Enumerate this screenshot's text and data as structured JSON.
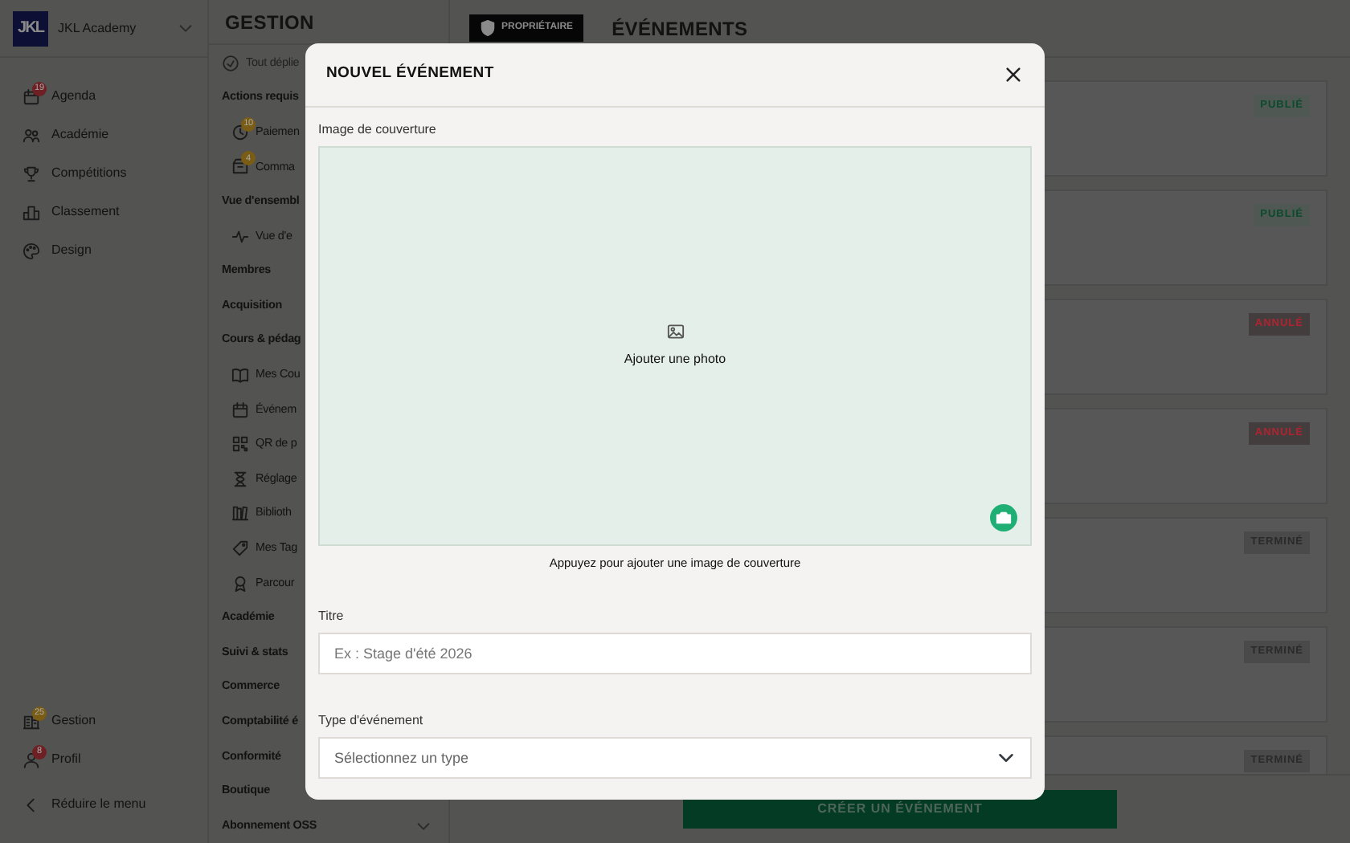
{
  "sidebar": {
    "logo": "JKL",
    "academy": "JKL Academy",
    "items": [
      {
        "label": "Agenda",
        "badge": {
          "text": "19",
          "color": "#6e2024"
        }
      },
      {
        "label": "Académie"
      },
      {
        "label": "Compétitions"
      },
      {
        "label": "Classement"
      },
      {
        "label": "Design"
      }
    ],
    "bottom_items": [
      {
        "label": "Gestion",
        "badge": {
          "text": "25",
          "color": "#7a5c14"
        }
      },
      {
        "label": "Profil",
        "badge": {
          "text": "8",
          "color": "#6e2024"
        }
      }
    ],
    "collapse": "Réduire le menu"
  },
  "subnav": {
    "title": "GESTION",
    "expand_all": "Tout déplie",
    "sections": [
      {
        "label": "Actions requis",
        "children": [
          {
            "label": "Paiemen",
            "badge": {
              "text": "10",
              "color": "#7a5c14"
            }
          },
          {
            "label": "Comma",
            "badge": {
              "text": "4",
              "color": "#7a5c14"
            }
          }
        ]
      },
      {
        "label": "Vue d'ensembl",
        "children": [
          {
            "label": "Vue d'e"
          }
        ]
      },
      {
        "label": "Membres"
      },
      {
        "label": "Acquisition"
      },
      {
        "label": "Cours & pédag",
        "children": [
          {
            "label": "Mes Cou"
          },
          {
            "label": "Événem"
          },
          {
            "label": "QR de p"
          },
          {
            "label": "Réglage"
          },
          {
            "label": "Biblioth"
          },
          {
            "label": "Mes Tag"
          },
          {
            "label": "Parcour"
          }
        ]
      },
      {
        "label": "Académie"
      },
      {
        "label": "Suivi & stats"
      },
      {
        "label": "Commerce"
      },
      {
        "label": "Comptabilité é"
      },
      {
        "label": "Conformité"
      },
      {
        "label": "Boutique"
      },
      {
        "label": "Abonnement OSS",
        "expanded": false
      }
    ]
  },
  "header": {
    "role_badge": "PROPRIÉTAIRE",
    "title": "ÉVÉNEMENTS"
  },
  "events": [
    {
      "status": "PUBLIÉ",
      "kind": "published"
    },
    {
      "status": "PUBLIÉ",
      "kind": "published"
    },
    {
      "status": "ANNULÉ",
      "kind": "cancelled"
    },
    {
      "status": "ANNULÉ",
      "kind": "cancelled"
    },
    {
      "status": "TERMINÉ",
      "kind": "finished"
    },
    {
      "status": "TERMINÉ",
      "kind": "finished"
    },
    {
      "status": "TERMINÉ",
      "kind": "finished"
    }
  ],
  "create_button": "CRÉER UN ÉVÉNEMENT",
  "modal": {
    "title": "NOUVEL ÉVÉNEMENT",
    "cover_label": "Image de couverture",
    "cover_hint": "Ajouter une photo",
    "cover_caption": "Appuyez pour ajouter une image de couverture",
    "fields": [
      {
        "kind": "text",
        "label": "Titre",
        "placeholder": "Ex : Stage d'été 2026"
      },
      {
        "kind": "select",
        "label": "Type d'événement",
        "placeholder": "Sélectionnez un type"
      }
    ]
  }
}
